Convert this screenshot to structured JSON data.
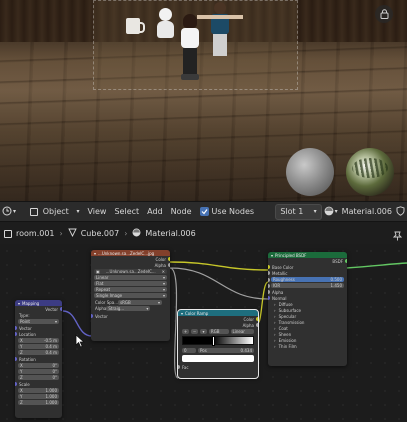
{
  "viewport": {
    "lock_icon": "lock-icon"
  },
  "header": {
    "editor_type_icon": "clock-icon",
    "object_mode_label": "Object",
    "menu": [
      "View",
      "Select",
      "Add",
      "Node"
    ],
    "use_nodes_label": "Use Nodes",
    "slot_label": "Slot 1",
    "material_name": "Material.006"
  },
  "breadcrumb": {
    "scene": "room.001",
    "object": "Cube.007",
    "material": "Material.006"
  },
  "nodes": {
    "mapping": {
      "title": "Mapping",
      "output": "Vector",
      "type_label": "Type:",
      "type_value": "Point",
      "vector": "Vector",
      "location": "Location",
      "loc": [
        [
          "X",
          "-0.5 m"
        ],
        [
          "Y",
          "0.4 m"
        ],
        [
          "Z",
          "0.4 m"
        ]
      ],
      "rotation": "Rotation",
      "rot": [
        [
          "X",
          "0°"
        ],
        [
          "Y",
          "0°"
        ],
        [
          "Z",
          "0°"
        ]
      ],
      "scale": "Scale",
      "scl": [
        [
          "X",
          "1.000"
        ],
        [
          "Y",
          "1.000"
        ],
        [
          "Z",
          "1.000"
        ]
      ]
    },
    "image": {
      "title": "...Unknown.sa...ZedeIC...jpg",
      "out_color": "Color",
      "out_alpha": "Alpha",
      "image_name": "...Unknown.sa...ZedeIC...",
      "interp": "Linear",
      "proj": "Flat",
      "ext": "Repeat",
      "source": "Single Image",
      "colorspace_label": "Color Spa...",
      "colorspace": "sRGB",
      "alpha_label": "Alpha",
      "alpha": "Straig...",
      "vector": "Vector"
    },
    "ramp": {
      "title": "Color Ramp",
      "out_color": "Color",
      "out_alpha": "Alpha",
      "mode": "RGB",
      "interp": "Linear",
      "pos_label": "Pos",
      "pos": "0.434",
      "stop": "0",
      "fac": "Fac"
    },
    "bsdf": {
      "title": "Principled BSDF",
      "out": "BSDF",
      "rows": [
        "Base Color",
        "Metallic",
        "Roughness",
        "IOR",
        "Alpha",
        "Normal",
        "Diffuse",
        "Subsurface",
        "Specular",
        "Transmission",
        "Coat",
        "Sheen",
        "Emission",
        "Thin Film"
      ],
      "roughness": "0.500",
      "ior": "1.450"
    }
  },
  "colors": {
    "mapping_header": "#3c3c83",
    "image_header": "#83402b",
    "ramp_header": "#1e6e7e",
    "bsdf_header": "#1b6b3b",
    "accent": "#4772b3"
  }
}
